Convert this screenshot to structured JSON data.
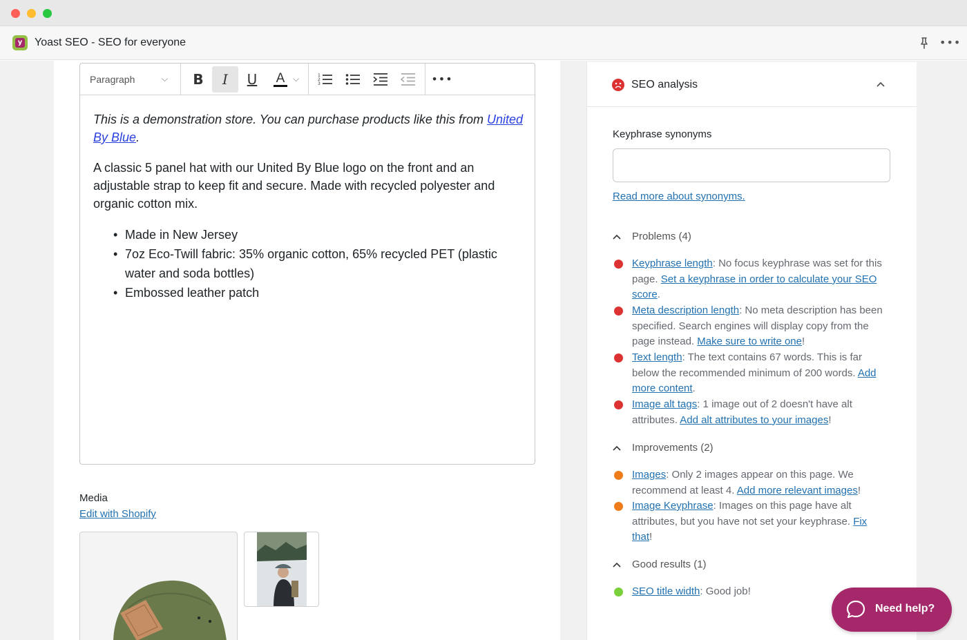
{
  "window": {
    "title": "Yoast SEO - SEO for everyone"
  },
  "colors": {
    "accent": "#a4286a",
    "link": "#2271b1",
    "problem": "#dc3232",
    "improvement": "#ee7c1b",
    "good": "#7ad03a"
  },
  "header": {
    "icons": [
      "app-logo-icon",
      "pin-icon",
      "more-icon"
    ]
  },
  "editor": {
    "toolbar": {
      "format_select": "Paragraph",
      "buttons": [
        "bold",
        "italic",
        "underline",
        "text-color",
        "numbered-list",
        "bulleted-list",
        "indent",
        "outdent",
        "more"
      ],
      "active": "italic",
      "bold_glyph": "B",
      "italic_glyph": "I",
      "underline_glyph": "U",
      "color_glyph": "A"
    },
    "intro_text": "This is a demonstration store. You can purchase products like this from ",
    "intro_link": "United By Blue",
    "intro_end": ".",
    "description": "A classic 5 panel hat with our United By Blue logo on the front and an adjustable strap to keep fit and secure. Made with recycled polyester and organic cotton mix.",
    "bullets": [
      "Made in New Jersey",
      "7oz Eco-Twill fabric: 35% organic cotton, 65% recycled PET (plastic water and soda bottles)",
      "Embossed leather patch"
    ]
  },
  "media": {
    "title": "Media",
    "edit_link": "Edit with Shopify"
  },
  "seo": {
    "title": "SEO analysis",
    "synonyms_label": "Keyphrase synonyms",
    "synonyms_value": "",
    "synonyms_link": "Read more about synonyms.",
    "problems": {
      "label": "Problems (4)",
      "items": [
        {
          "link": "Keyphrase length",
          "text": ": No focus keyphrase was set for this page. ",
          "link2": "Set a keyphrase in order to calculate your SEO score",
          "end": "."
        },
        {
          "link": "Meta description length",
          "text": ": No meta description has been specified. Search engines will display copy from the page instead. ",
          "link2": "Make sure to write one",
          "end": "!"
        },
        {
          "link": "Text length",
          "text": ": The text contains 67 words. This is far below the recommended minimum of 200 words. ",
          "link2": "Add more content",
          "end": "."
        },
        {
          "link": "Image alt tags",
          "text": ": 1 image out of 2 doesn't have alt attributes. ",
          "link2": "Add alt attributes to your images",
          "end": "!"
        }
      ]
    },
    "improvements": {
      "label": "Improvements (2)",
      "items": [
        {
          "link": "Images",
          "text": ": Only 2 images appear on this page. We recommend at least 4. ",
          "link2": "Add more relevant images",
          "end": "!"
        },
        {
          "link": "Image Keyphrase",
          "text": ": Images on this page have alt attributes, but you have not set your keyphrase. ",
          "link2": "Fix that",
          "end": "!"
        }
      ]
    },
    "good": {
      "label": "Good results (1)",
      "items": [
        {
          "link": "SEO title width",
          "text": ": Good job!",
          "link2": "",
          "end": ""
        }
      ]
    }
  },
  "help": {
    "label": "Need help?"
  }
}
